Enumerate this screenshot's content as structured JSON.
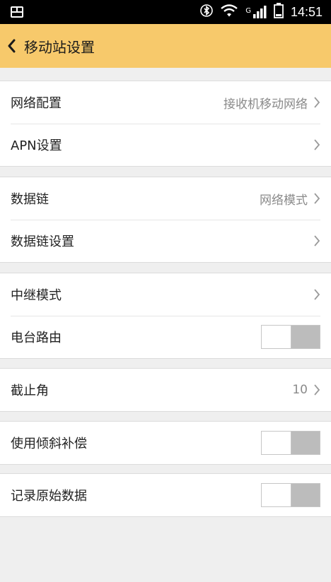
{
  "status_bar": {
    "time": "14:51",
    "network_type": "G",
    "icons": [
      "sim-card-icon",
      "bluetooth-icon",
      "wifi-icon",
      "cellular-signal-icon",
      "battery-icon"
    ]
  },
  "header": {
    "back_icon": "chevron-left-icon",
    "title": "移动站设置",
    "background_color": "#f7c96b"
  },
  "groups": [
    {
      "items": [
        {
          "label": "网络配置",
          "value": "接收机移动网络",
          "control": "chevron"
        },
        {
          "label": "APN设置",
          "value": "",
          "control": "chevron"
        }
      ]
    },
    {
      "items": [
        {
          "label": "数据链",
          "value": "网络模式",
          "control": "chevron"
        },
        {
          "label": "数据链设置",
          "value": "",
          "control": "chevron"
        }
      ]
    },
    {
      "items": [
        {
          "label": "中继模式",
          "value": "",
          "control": "chevron"
        },
        {
          "label": "电台路由",
          "control": "toggle",
          "toggle_on": false
        }
      ]
    },
    {
      "items": [
        {
          "label": "截止角",
          "value": "10",
          "control": "chevron"
        }
      ]
    },
    {
      "items": [
        {
          "label": "使用倾斜补偿",
          "control": "toggle",
          "toggle_on": false
        }
      ]
    },
    {
      "items": [
        {
          "label": "记录原始数据",
          "control": "toggle",
          "toggle_on": false
        }
      ]
    }
  ]
}
